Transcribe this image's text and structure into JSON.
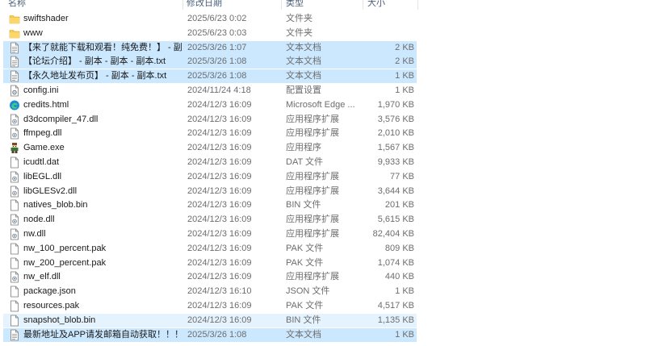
{
  "columns": {
    "name": "名称",
    "date": "修改日期",
    "type": "类型",
    "size": "大小"
  },
  "files": [
    {
      "name": "swiftshader",
      "date": "2025/6/23 0:02",
      "type": "文件夹",
      "size": "",
      "icon": "folder-icon",
      "state": ""
    },
    {
      "name": "www",
      "date": "2025/6/23 0:03",
      "type": "文件夹",
      "size": "",
      "icon": "folder-icon",
      "state": ""
    },
    {
      "name": "【来了就能下载和观看！纯免费！】 - 副...",
      "date": "2025/3/26 1:07",
      "type": "文本文档",
      "size": "2 KB",
      "icon": "text-file-icon",
      "state": "selected"
    },
    {
      "name": "【论坛介绍】 - 副本 - 副本 - 副本.txt",
      "date": "2025/3/26 1:08",
      "type": "文本文档",
      "size": "2 KB",
      "icon": "text-file-icon",
      "state": "selected"
    },
    {
      "name": "【永久地址发布页】 - 副本 - 副本.txt",
      "date": "2025/3/26 1:08",
      "type": "文本文档",
      "size": "1 KB",
      "icon": "text-file-icon",
      "state": "selected"
    },
    {
      "name": "config.ini",
      "date": "2024/11/24 4:18",
      "type": "配置设置",
      "size": "1 KB",
      "icon": "config-file-icon",
      "state": ""
    },
    {
      "name": "credits.html",
      "date": "2024/12/3 16:09",
      "type": "Microsoft Edge ...",
      "size": "1,970 KB",
      "icon": "edge-icon",
      "state": ""
    },
    {
      "name": "d3dcompiler_47.dll",
      "date": "2024/12/3 16:09",
      "type": "应用程序扩展",
      "size": "3,576 KB",
      "icon": "dll-file-icon",
      "state": ""
    },
    {
      "name": "ffmpeg.dll",
      "date": "2024/12/3 16:09",
      "type": "应用程序扩展",
      "size": "2,010 KB",
      "icon": "dll-file-icon",
      "state": ""
    },
    {
      "name": "Game.exe",
      "date": "2024/12/3 16:09",
      "type": "应用程序",
      "size": "1,567 KB",
      "icon": "game-exe-icon",
      "state": ""
    },
    {
      "name": "icudtl.dat",
      "date": "2024/12/3 16:09",
      "type": "DAT 文件",
      "size": "9,933 KB",
      "icon": "blank-file-icon",
      "state": ""
    },
    {
      "name": "libEGL.dll",
      "date": "2024/12/3 16:09",
      "type": "应用程序扩展",
      "size": "77 KB",
      "icon": "dll-file-icon",
      "state": ""
    },
    {
      "name": "libGLESv2.dll",
      "date": "2024/12/3 16:09",
      "type": "应用程序扩展",
      "size": "3,644 KB",
      "icon": "dll-file-icon",
      "state": ""
    },
    {
      "name": "natives_blob.bin",
      "date": "2024/12/3 16:09",
      "type": "BIN 文件",
      "size": "201 KB",
      "icon": "blank-file-icon",
      "state": ""
    },
    {
      "name": "node.dll",
      "date": "2024/12/3 16:09",
      "type": "应用程序扩展",
      "size": "5,615 KB",
      "icon": "dll-file-icon",
      "state": ""
    },
    {
      "name": "nw.dll",
      "date": "2024/12/3 16:09",
      "type": "应用程序扩展",
      "size": "82,404 KB",
      "icon": "dll-file-icon",
      "state": ""
    },
    {
      "name": "nw_100_percent.pak",
      "date": "2024/12/3 16:09",
      "type": "PAK 文件",
      "size": "809 KB",
      "icon": "blank-file-icon",
      "state": ""
    },
    {
      "name": "nw_200_percent.pak",
      "date": "2024/12/3 16:09",
      "type": "PAK 文件",
      "size": "1,074 KB",
      "icon": "blank-file-icon",
      "state": ""
    },
    {
      "name": "nw_elf.dll",
      "date": "2024/12/3 16:09",
      "type": "应用程序扩展",
      "size": "440 KB",
      "icon": "dll-file-icon",
      "state": ""
    },
    {
      "name": "package.json",
      "date": "2024/12/3 16:10",
      "type": "JSON 文件",
      "size": "1 KB",
      "icon": "blank-file-icon",
      "state": ""
    },
    {
      "name": "resources.pak",
      "date": "2024/12/3 16:09",
      "type": "PAK 文件",
      "size": "4,517 KB",
      "icon": "blank-file-icon",
      "state": ""
    },
    {
      "name": "snapshot_blob.bin",
      "date": "2024/12/3 16:09",
      "type": "BIN 文件",
      "size": "1,135 KB",
      "icon": "blank-file-icon",
      "state": "hover"
    },
    {
      "name": "最新地址及APP请发邮箱自动获取！！！...",
      "date": "2025/3/26 1:08",
      "type": "文本文档",
      "size": "1 KB",
      "icon": "text-file-icon",
      "state": "selected"
    }
  ],
  "colors": {
    "selected": "#cce8ff",
    "hover": "#e5f3ff",
    "folder": "#f8c94a",
    "edge": "#1b8ad6"
  }
}
